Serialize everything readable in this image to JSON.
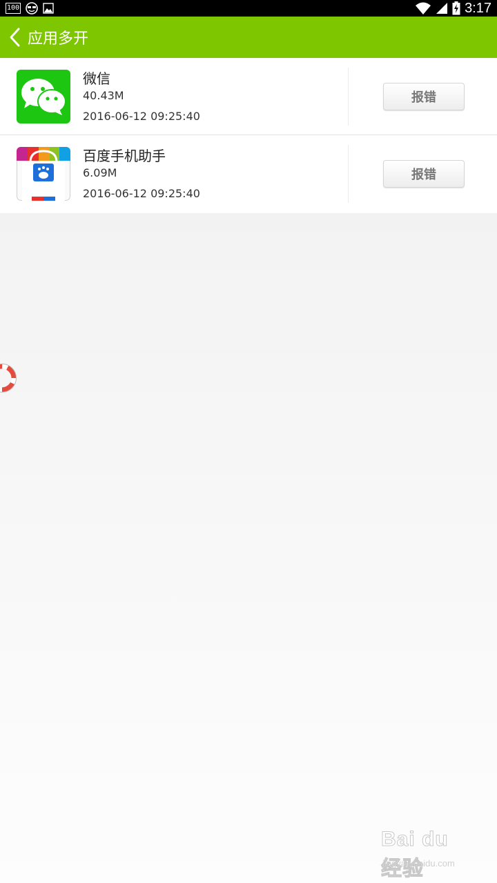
{
  "status_bar": {
    "badge": "100",
    "time": "3:17",
    "icons": [
      "battery-saver-icon",
      "face-icon",
      "image-icon",
      "wifi-icon",
      "signal-icon",
      "battery-charging-icon"
    ]
  },
  "title_bar": {
    "title": "应用多开",
    "back_icon": "chevron-left-icon",
    "background": "#7ec700"
  },
  "apps": [
    {
      "name": "微信",
      "size": "40.43M",
      "date": "2016-06-12 09:25:40",
      "icon": "wechat-icon",
      "report_label": "报错"
    },
    {
      "name": "百度手机助手",
      "size": "6.09M",
      "date": "2016-06-12 09:25:40",
      "icon": "baidu-assistant-icon",
      "report_label": "报错"
    }
  ],
  "floating_button": {
    "icon": "lifebuoy-icon"
  },
  "watermark": {
    "main": "Bai du 经验",
    "sub": "jingyan.baidu.com"
  }
}
